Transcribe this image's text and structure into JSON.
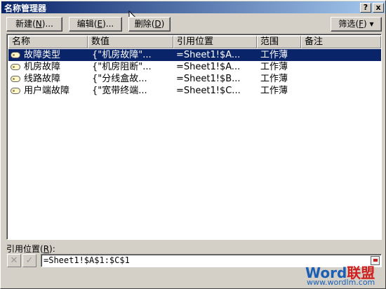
{
  "window": {
    "title": "名称管理器",
    "help_label": "?",
    "close_label": "x"
  },
  "toolbar": {
    "new": {
      "label": "新建",
      "key": "N",
      "suffix": "..."
    },
    "edit": {
      "label": "编辑",
      "key": "E",
      "suffix": "..."
    },
    "delete": {
      "label": "删除",
      "key": "D",
      "suffix": ""
    },
    "filter": {
      "label": "筛选",
      "key": "F",
      "arrow": "▾"
    }
  },
  "table": {
    "columns": [
      "名称",
      "数值",
      "引用位置",
      "范围",
      "备注"
    ],
    "rows": [
      {
        "name": "故障类型",
        "value": "{\"机房故障\"...",
        "ref": "=Sheet1!$A...",
        "scope": "工作薄",
        "comment": "",
        "selected": true
      },
      {
        "name": "机房故障",
        "value": "{\"机房阻断\"...",
        "ref": "=Sheet1!$A...",
        "scope": "工作薄",
        "comment": "",
        "selected": false
      },
      {
        "name": "线路故障",
        "value": "{\"分线盒故...",
        "ref": "=Sheet1!$B...",
        "scope": "工作薄",
        "comment": "",
        "selected": false
      },
      {
        "name": "用户端故障",
        "value": "{\"宽带终端...",
        "ref": "=Sheet1!$C...",
        "scope": "工作薄",
        "comment": "",
        "selected": false
      }
    ]
  },
  "reference": {
    "label": "引用位置",
    "key": "R",
    "value": "=Sheet1!$A$1:$C$1",
    "cancel_glyph": "✕",
    "confirm_glyph": "✓"
  },
  "watermark": {
    "logo_a": "Word",
    "logo_b": "联盟",
    "site": "www.wordlm.com"
  },
  "icons": {
    "row_icon": "range-name-icon",
    "collapse": "collapse-dialog-icon"
  }
}
